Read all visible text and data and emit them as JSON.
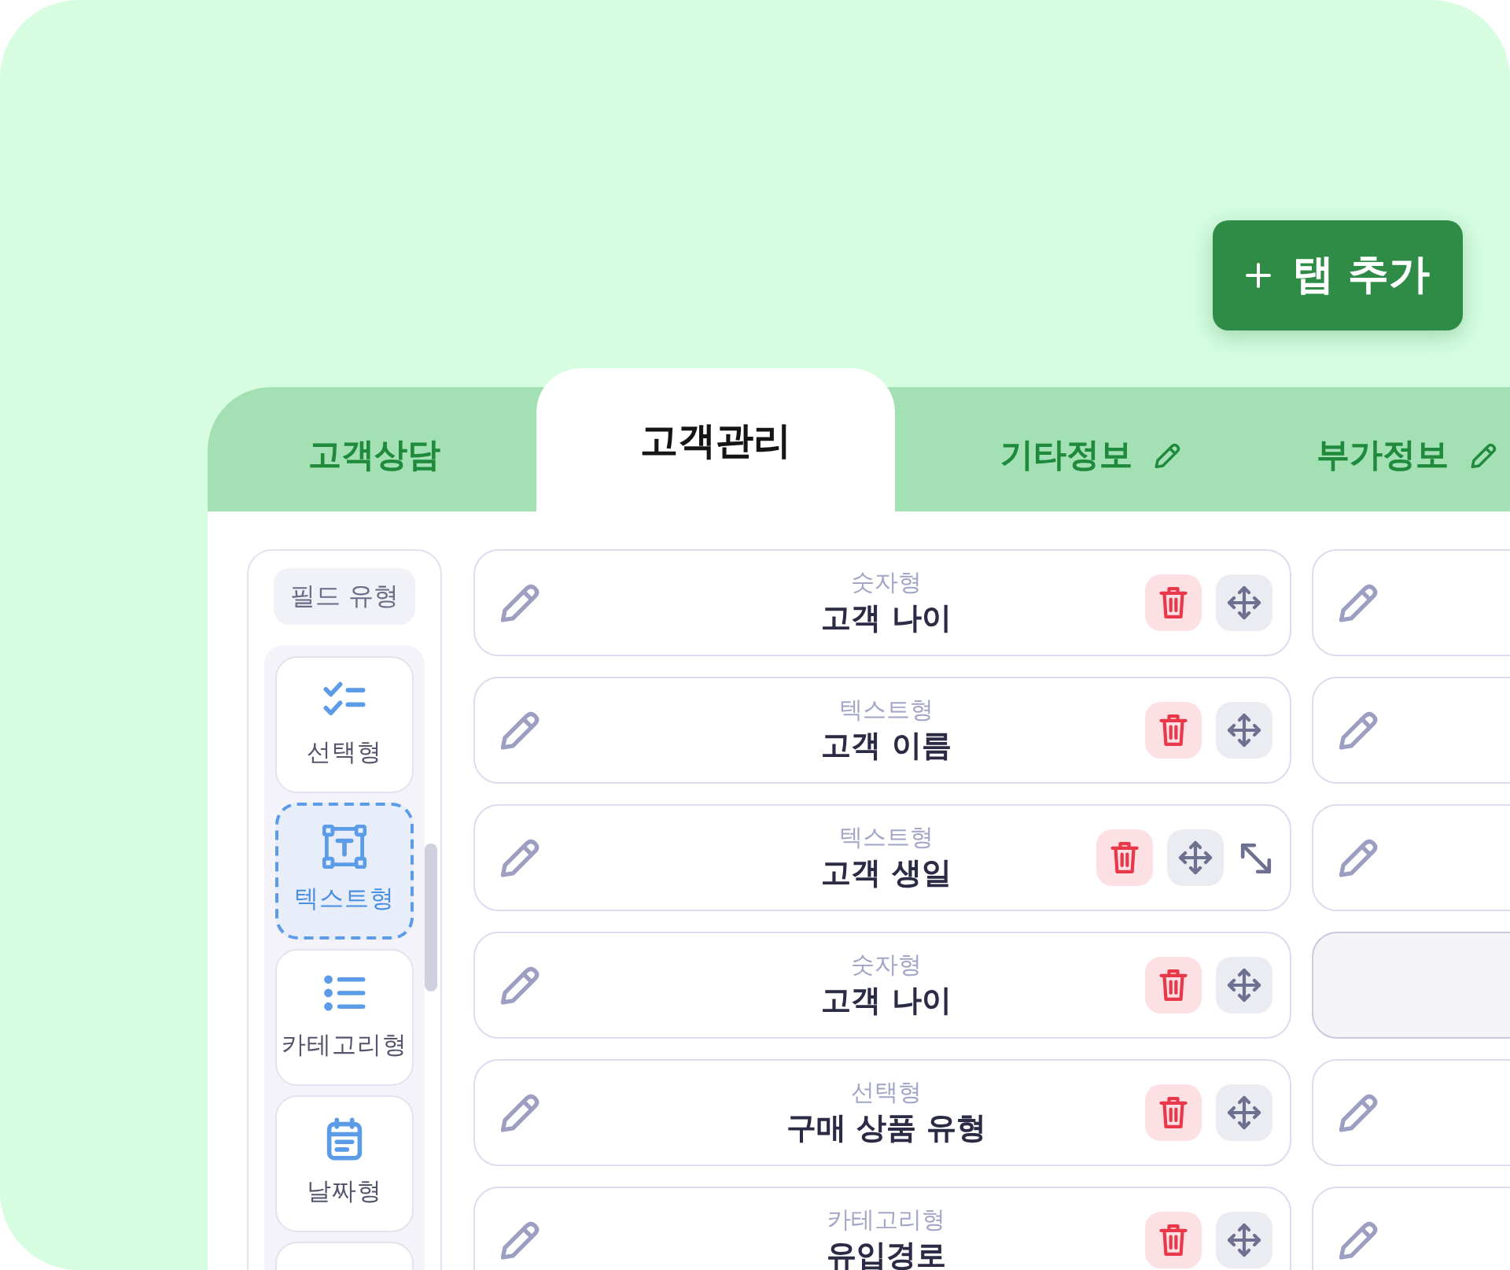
{
  "add_tab_button": {
    "label": "탭 추가"
  },
  "tabs": [
    {
      "label": "고객상담",
      "selected": false,
      "editable": false
    },
    {
      "label": "고객관리",
      "selected": true,
      "editable": false
    },
    {
      "label": "기타정보",
      "selected": false,
      "editable": true
    },
    {
      "label": "부가정보",
      "selected": false,
      "editable": true
    }
  ],
  "field_types": {
    "title": "필드 유형",
    "items": [
      {
        "kind": "checklist",
        "label": "선택형",
        "selected": false
      },
      {
        "kind": "textbox",
        "label": "텍스트형",
        "selected": true
      },
      {
        "kind": "list",
        "label": "카테고리형",
        "selected": false
      },
      {
        "kind": "calendar",
        "label": "날짜형",
        "selected": false
      },
      {
        "selected": false
      }
    ]
  },
  "columns": [
    {
      "rows": [
        {
          "kind": "field",
          "type": "숫자형",
          "name": "고객 나이",
          "resizable": false
        },
        {
          "kind": "field",
          "type": "텍스트형",
          "name": "고객 이름",
          "resizable": false
        },
        {
          "kind": "field",
          "type": "텍스트형",
          "name": "고객 생일",
          "resizable": true
        },
        {
          "kind": "field",
          "type": "숫자형",
          "name": "고객 나이",
          "resizable": false
        },
        {
          "kind": "field",
          "type": "선택형",
          "name": "구매 상품 유형",
          "resizable": false
        },
        {
          "kind": "field",
          "type": "카테고리형",
          "name": "유입경로",
          "resizable": false
        }
      ]
    },
    {
      "rows": [
        {
          "kind": "field"
        },
        {
          "kind": "field"
        },
        {
          "kind": "field"
        },
        {
          "kind": "placeholder"
        },
        {
          "kind": "field"
        },
        {
          "kind": "field"
        }
      ]
    }
  ]
}
